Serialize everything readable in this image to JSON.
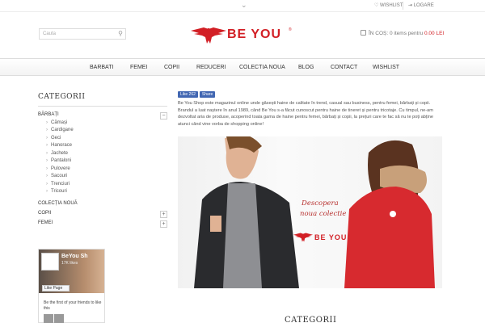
{
  "topbar": {
    "wishlist": "WISHLIST",
    "login": "LOGARE"
  },
  "search": {
    "placeholder": "Cauta"
  },
  "logo": {
    "text": "BE YOU",
    "reg": "®"
  },
  "cart": {
    "label": "ÎN COȘ: 0 items  pentru",
    "price": "0.00 LEI"
  },
  "nav": {
    "items": [
      "BARBATI",
      "FEMEI",
      "COPII",
      "REDUCERI",
      "COLECTIA NOUA",
      "BLOG",
      "CONTACT",
      "WISHLIST"
    ]
  },
  "sidebar": {
    "title": "CATEGORII",
    "main": "BĂRBAȚI",
    "subcategories": [
      "Cămași",
      "Cardigane",
      "Geci",
      "Hanorace",
      "Jachete",
      "Pantaloni",
      "Pulovere",
      "Sacouri",
      "Trenciuri",
      "Tricouri"
    ],
    "colectia": "COLECȚIA NOUĂ",
    "copii": "COPII",
    "femei": "FEMEI",
    "toggle_minus": "−",
    "toggle_plus": "+"
  },
  "facebook": {
    "page_name": "BeYou Sh",
    "likes": "17K likes",
    "like_button": "Like Page",
    "first": "Be the first of your friends to like this"
  },
  "likebar": {
    "like": "Like 262",
    "share": "Share"
  },
  "intro": "Be You Shop este magazinul online unde găsești haine de calitate în trend, casual sau business, pentru femei, bărbați și copii. Brandul a luat naștere în anul 1989, când Be You s-a făcut cunoscut pentru haine de tineret și pentru tricotaje. Cu timpul, ne-am dezvoltat aria de produse, acoperind toata gama de haine pentru femei, bărbați și copii, la prețuri care te fac să nu te poți abține atunci când vine vorba de shopping online!",
  "banner": {
    "line1": "Descopera",
    "line2": "noua colectie",
    "brand": "BE YOU"
  },
  "bottom": {
    "title": "CATEGORII"
  },
  "colors": {
    "brand_red": "#d21f25",
    "facebook_blue": "#4267b2"
  }
}
